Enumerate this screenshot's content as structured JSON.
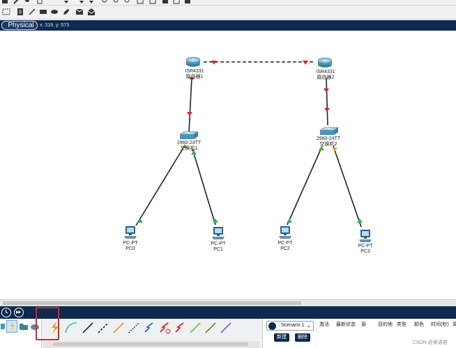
{
  "top_toolbar": {
    "icons": [
      "select-icon",
      "note-icon",
      "line-icon",
      "rectangle-icon",
      "ellipse-icon",
      "freeform-icon",
      "mail-icon",
      "open-mail-icon"
    ]
  },
  "workspace": {
    "mode_tab": "Physical",
    "coordinates": "x: 319, y: 573"
  },
  "topology": {
    "routers": [
      {
        "model": "ISR4331",
        "name": "路由器1"
      },
      {
        "model": "ISR4331",
        "name": "路由器2"
      }
    ],
    "switches": [
      {
        "model": "2960-24TT",
        "name": "交换机1"
      },
      {
        "model": "2960-24TT",
        "name": "交换机2"
      }
    ],
    "pcs": [
      {
        "model": "PC-PT",
        "name": "PC0"
      },
      {
        "model": "PC-PT",
        "name": "PC1"
      },
      {
        "model": "PC-PT",
        "name": "PC2"
      },
      {
        "model": "PC-PT",
        "name": "PC3"
      }
    ]
  },
  "colors": {
    "nav": "#0e2a4f",
    "link_up": "#3cb043",
    "link_down": "#d9262a",
    "link_orange": "#f29b1d",
    "highlight_box": "#d9262a"
  },
  "bottom_panel": {
    "scenario": "Scenario 1",
    "new_button": "新建",
    "delete_button": "删除",
    "pdu_headers": [
      "激活",
      "最新状态",
      "源",
      "目的地",
      "类型",
      "颜色",
      "时间(秒)",
      "周"
    ]
  },
  "watermark": "CSDN @吴语君"
}
